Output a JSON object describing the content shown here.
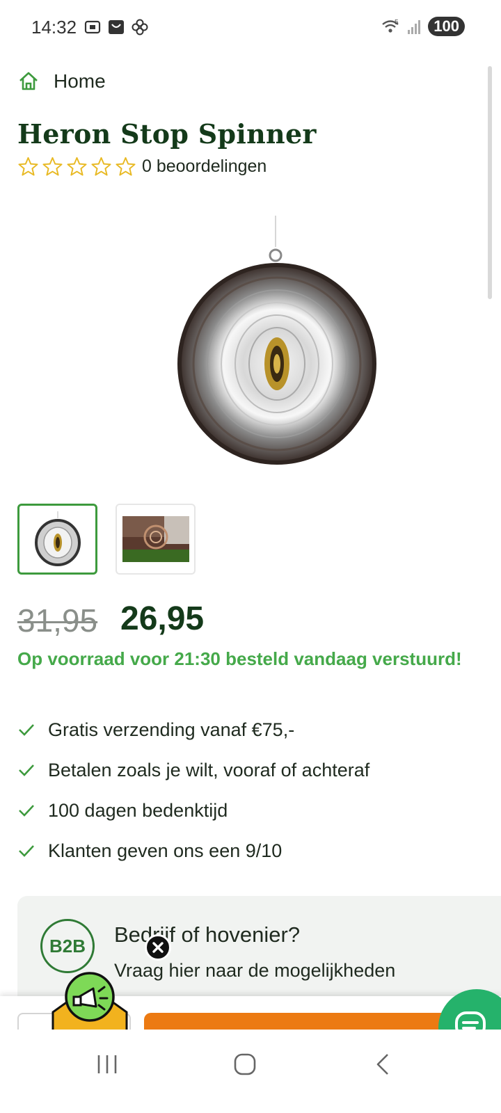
{
  "status_bar": {
    "time": "14:32",
    "left_icons": [
      "screenshot-icon",
      "shop-icon",
      "pinwheel-icon"
    ],
    "network": "5",
    "battery": "100"
  },
  "breadcrumb": {
    "label": "Home"
  },
  "product": {
    "title": "Heron Stop Spinner",
    "rating": {
      "stars": 0,
      "max_stars": 5,
      "reviews_label": "0 beoordelingen"
    },
    "old_price": "31,95",
    "new_price": "26,95",
    "stock_message": "Op voorraad voor 21:30 besteld vandaag verstuurd!"
  },
  "usps": [
    "Gratis verzending vanaf €75,-",
    "Betalen zoals je wilt, vooraf of achteraf",
    "100 dagen bedenktijd",
    "Klanten geven ons een 9/10"
  ],
  "b2b": {
    "badge": "B2B",
    "title": "Bedrijf of hovenier?",
    "subtitle": "Vraag hier naar de mogelijkheden"
  },
  "colors": {
    "brand_green": "#3d9a3d",
    "stock_green": "#45a94a",
    "title_green": "#143a1a",
    "cart_orange": "#ec7a12",
    "chat_green": "#25b26b",
    "star_yellow": "#e8b923"
  }
}
